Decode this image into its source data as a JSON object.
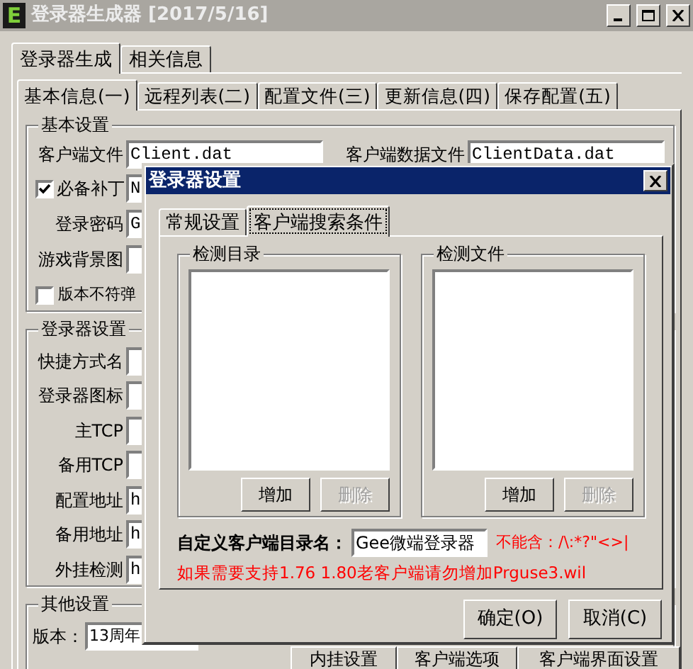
{
  "window": {
    "title": "登录器生成器 [2017/5/16]",
    "icon_letter": "E"
  },
  "main_tabs": [
    {
      "label": "登录器生成",
      "selected": true
    },
    {
      "label": "相关信息",
      "selected": false
    }
  ],
  "sub_tabs": [
    {
      "label": "基本信息(一)",
      "selected": true
    },
    {
      "label": "远程列表(二)",
      "selected": false
    },
    {
      "label": "配置文件(三)",
      "selected": false
    },
    {
      "label": "更新信息(四)",
      "selected": false
    },
    {
      "label": "保存配置(五)",
      "selected": false
    }
  ],
  "basic": {
    "title": "基本设置",
    "client_file": {
      "label": "客户端文件",
      "value": "Client.dat"
    },
    "client_data_file": {
      "label": "客户端数据文件",
      "value": "ClientData.dat"
    },
    "rows": [
      {
        "kind": "checkfield",
        "label": "必备补丁",
        "checked": true,
        "value": "N"
      },
      {
        "kind": "field",
        "label": "登录密码",
        "value": "G"
      },
      {
        "kind": "field",
        "label": "游戏背景图"
      },
      {
        "kind": "check",
        "label": "版本不符弹",
        "checked": false
      }
    ]
  },
  "launcher": {
    "title": "登录器设置",
    "rows": [
      {
        "label": "快捷方式名"
      },
      {
        "label": "登录器图标"
      },
      {
        "label": "主TCP"
      },
      {
        "label": "备用TCP"
      },
      {
        "label": "配置地址",
        "value": "h"
      },
      {
        "label": "备用地址",
        "value": "h"
      },
      {
        "label": "外挂检测",
        "value": "h"
      }
    ]
  },
  "other": {
    "title": "其他设置",
    "version": {
      "label": "版本：",
      "value": "13周年"
    }
  },
  "bottom_buttons": [
    "内挂设置",
    "客户端选项",
    "客户端界面设置"
  ],
  "dialog": {
    "title": "登录器设置",
    "tabs": [
      {
        "label": "常规设置",
        "selected": false
      },
      {
        "label": "客户端搜索条件",
        "selected": true
      }
    ],
    "groups": [
      {
        "title": "检测目录",
        "buttons": [
          {
            "label": "增加",
            "disabled": false
          },
          {
            "label": "删除",
            "disabled": true
          }
        ]
      },
      {
        "title": "检测文件",
        "buttons": [
          {
            "label": "增加",
            "disabled": false
          },
          {
            "label": "删除",
            "disabled": true
          }
        ]
      }
    ],
    "custom_dir": {
      "label": "自定义客户端目录名：",
      "value": "Gee微端登录器",
      "warning": "不能含：/\\:*?\"<>|"
    },
    "note": "如果需要支持1.76 1.80老客户端请勿增加Prguse3.wil",
    "buttons": [
      "确定(O)",
      "取消(C)"
    ]
  }
}
